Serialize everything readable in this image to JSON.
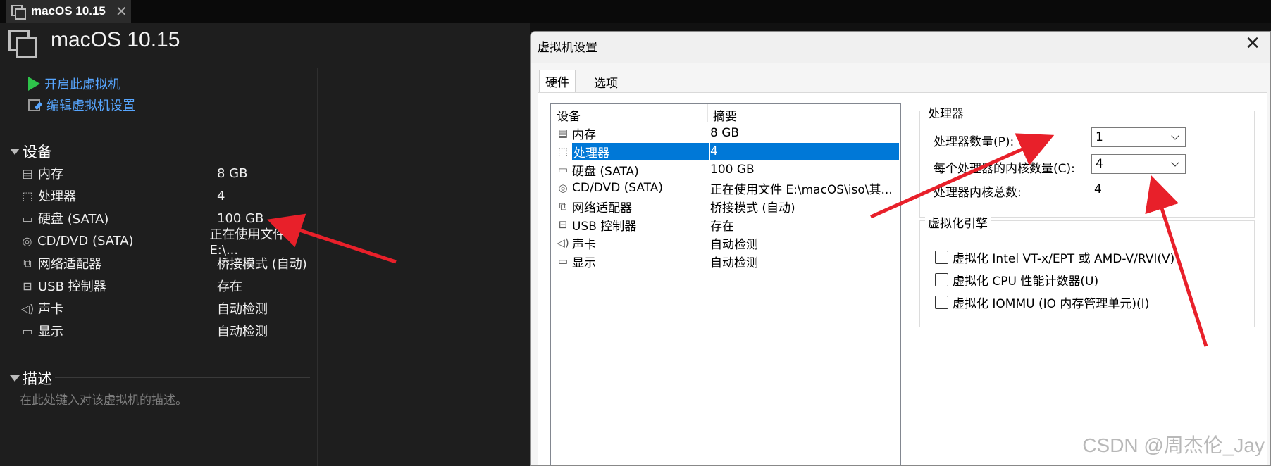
{
  "tab": {
    "title": "macOS 10.15"
  },
  "vm": {
    "title": "macOS 10.15",
    "actions": {
      "power_on": "开启此虚拟机",
      "edit_settings": "编辑虚拟机设置"
    },
    "devices_header": "设备",
    "devices": [
      {
        "name": "内存",
        "value": "8 GB",
        "icon": "memory-icon"
      },
      {
        "name": "处理器",
        "value": "4",
        "icon": "processor-icon"
      },
      {
        "name": "硬盘 (SATA)",
        "value": "100 GB",
        "icon": "harddisk-icon"
      },
      {
        "name": "CD/DVD (SATA)",
        "value": "正在使用文件 E:\\...",
        "icon": "cdrom-icon"
      },
      {
        "name": "网络适配器",
        "value": "桥接模式 (自动)",
        "icon": "network-icon"
      },
      {
        "name": "USB 控制器",
        "value": "存在",
        "icon": "usb-icon"
      },
      {
        "name": "声卡",
        "value": "自动检测",
        "icon": "sound-icon"
      },
      {
        "name": "显示",
        "value": "自动检测",
        "icon": "display-icon"
      }
    ],
    "desc_header": "描述",
    "desc_placeholder": "在此处键入对该虚拟机的描述。"
  },
  "dialog": {
    "title": "虚拟机设置",
    "tabs": [
      "硬件",
      "选项"
    ],
    "list": {
      "col_device": "设备",
      "col_summary": "摘要",
      "rows": [
        {
          "name": "内存",
          "value": "8 GB"
        },
        {
          "name": "处理器",
          "value": "4"
        },
        {
          "name": "硬盘 (SATA)",
          "value": "100 GB"
        },
        {
          "name": "CD/DVD (SATA)",
          "value": "正在使用文件 E:\\macOS\\iso\\其..."
        },
        {
          "name": "网络适配器",
          "value": "桥接模式 (自动)"
        },
        {
          "name": "USB 控制器",
          "value": "存在"
        },
        {
          "name": "声卡",
          "value": "自动检测"
        },
        {
          "name": "显示",
          "value": "自动检测"
        }
      ]
    },
    "processor": {
      "group_title": "处理器",
      "count_label": "处理器数量(P):",
      "count_value": "1",
      "cores_label": "每个处理器的内核数量(C):",
      "cores_value": "4",
      "total_label": "处理器内核总数:",
      "total_value": "4"
    },
    "virtualization": {
      "group_title": "虚拟化引擎",
      "options": [
        "虚拟化 Intel VT-x/EPT 或 AMD-V/RVI(V)",
        "虚拟化 CPU 性能计数器(U)",
        "虚拟化 IOMMU (IO 内存管理单元)(I)"
      ]
    }
  },
  "watermark": "CSDN @周杰伦_Jay",
  "colors": {
    "selection": "#0078d7",
    "link": "#57a6ff",
    "annotation": "#e8202a"
  }
}
